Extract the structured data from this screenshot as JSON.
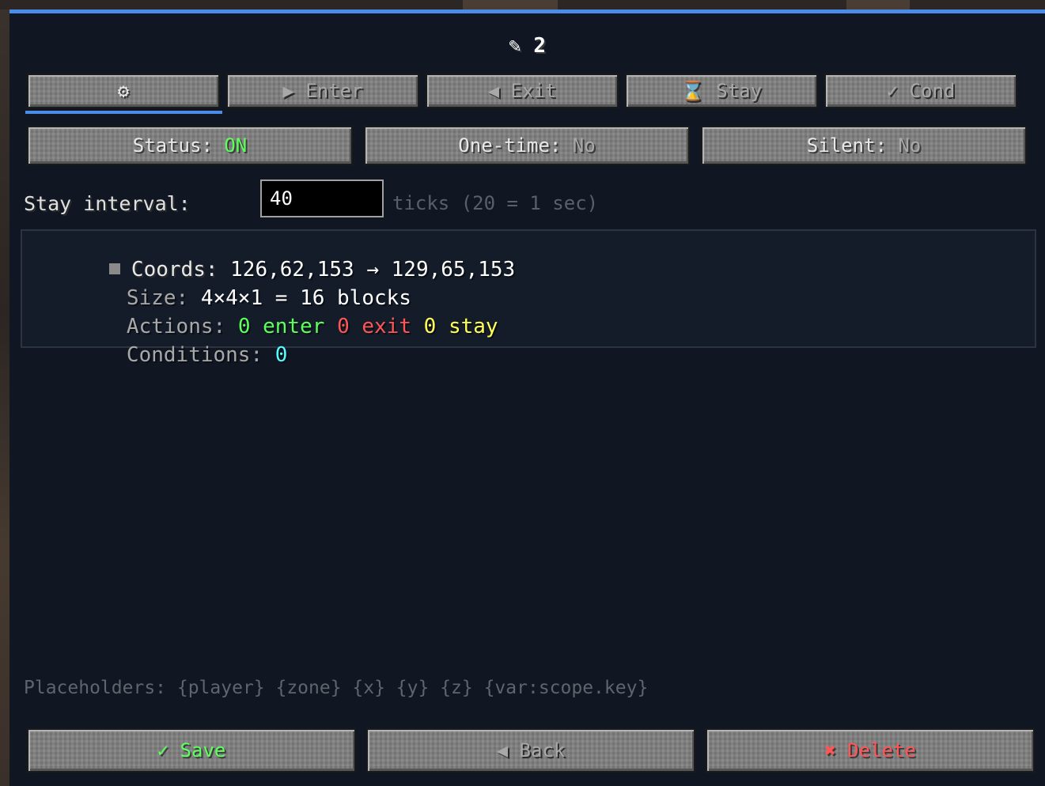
{
  "title": "✎ 2",
  "tabs": [
    {
      "label": "⚙",
      "active": true
    },
    {
      "label": "▶ Enter",
      "active": false
    },
    {
      "label": "◀ Exit",
      "active": false
    },
    {
      "label": "⌛ Stay",
      "active": false
    },
    {
      "label": "✓ Cond",
      "active": false
    }
  ],
  "toggles": {
    "status": {
      "label": "Status: ",
      "value": "ON"
    },
    "one_time": {
      "label": "One-time: ",
      "value": "No"
    },
    "silent": {
      "label": "Silent: ",
      "value": "No"
    }
  },
  "stay": {
    "label": "Stay interval:",
    "value": "40",
    "hint": "ticks (20 = 1 sec)"
  },
  "info": {
    "coords_label": "Coords: ",
    "coords_value": "126,62,153 → 129,65,153",
    "size_label": "Size: ",
    "size_value": "4×4×1 = 16 blocks",
    "actions_label": "Actions: ",
    "enter_count": "0",
    "enter_label": "enter",
    "exit_count": "0",
    "exit_label": "exit",
    "stay_count": "0",
    "stay_label": "stay",
    "conditions_label": "Conditions: ",
    "conditions_value": "0"
  },
  "placeholders": "Placeholders: {player} {zone} {x} {y} {z} {var:scope.key}",
  "buttons": {
    "save": {
      "icon": "✓",
      "label": "Save"
    },
    "back": {
      "icon": "◀",
      "label": "Back"
    },
    "delete": {
      "icon": "✖",
      "label": "Delete"
    }
  },
  "colors": {
    "accent": "#4a8ce8",
    "on_green": "#5dff5d",
    "exit_red": "#ff5555",
    "stay_yellow": "#ffff55",
    "cond_cyan": "#55ffff"
  }
}
